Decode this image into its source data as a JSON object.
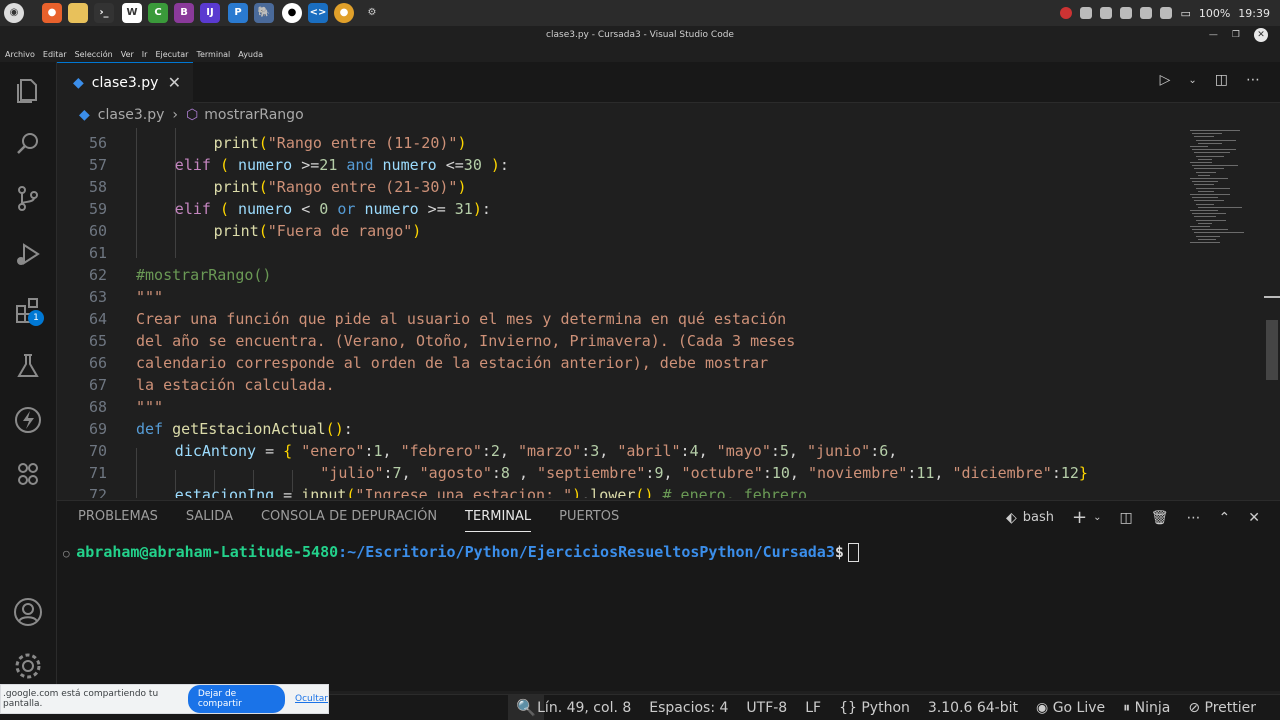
{
  "window": {
    "title": "clase3.py - Cursada3 - Visual Studio Code"
  },
  "os": {
    "taskbar_icons": [
      "menu-icon",
      "firefox-icon",
      "files-icon",
      "terminal-icon",
      "libreoffice-writer-icon",
      "libreoffice-calc-icon",
      "libreoffice-base-icon",
      "intellij-icon",
      "pycharm-icon",
      "postgres-icon",
      "github-icon",
      "vscode-icon",
      "chrome-icon",
      "settings-icon"
    ],
    "battery": "100%",
    "clock": "19:39"
  },
  "menu": [
    "Archivo",
    "Editar",
    "Selección",
    "Ver",
    "Ir",
    "Ejecutar",
    "Terminal",
    "Ayuda"
  ],
  "tab": {
    "label": "clase3.py",
    "close": "✕"
  },
  "breadcrumb": {
    "file": "clase3.py",
    "separator": "›",
    "symbol": "mostrarRango"
  },
  "activity_badge": "1",
  "code": {
    "lines": [
      {
        "n": "56",
        "text": "print(\"Rango entre (11-20)\")"
      },
      {
        "n": "57",
        "text": "elif ( numero >=21 and numero <=30 ):"
      },
      {
        "n": "58",
        "text": "print(\"Rango entre (21-30)\")"
      },
      {
        "n": "59",
        "text": "elif ( numero < 0 or numero >= 31):"
      },
      {
        "n": "60",
        "text": "print(\"Fuera de rango\")"
      },
      {
        "n": "61",
        "text": ""
      },
      {
        "n": "62",
        "text": "#mostrarRango()"
      },
      {
        "n": "63",
        "text": "\"\"\""
      },
      {
        "n": "64",
        "text": "Crear una función que pide al usuario el mes y determina en qué estación"
      },
      {
        "n": "65",
        "text": "del año se encuentra. (Verano, Otoño, Invierno, Primavera). (Cada 3 meses"
      },
      {
        "n": "66",
        "text": "calendario corresponde al orden de la estación anterior), debe mostrar"
      },
      {
        "n": "67",
        "text": "la estación calculada."
      },
      {
        "n": "68",
        "text": "\"\"\""
      },
      {
        "n": "69",
        "text": "def getEstacionActual():"
      },
      {
        "n": "70",
        "text": "dicAntony = { \"enero\":1, \"febrero\":2, \"marzo\":3, \"abril\":4, \"mayo\":5, \"junio\":6,"
      },
      {
        "n": "71",
        "text": "\"julio\":7, \"agosto\":8 , \"septiembre\":9, \"octubre\":10, \"noviembre\":11, \"diciembre\":12}"
      },
      {
        "n": "72",
        "text": "estacionIng = input(\"Ingrese una estacion: \").lower() # enero, febrero"
      }
    ]
  },
  "panel": {
    "tabs": [
      "PROBLEMAS",
      "SALIDA",
      "CONSOLA DE DEPURACIÓN",
      "TERMINAL",
      "PUERTOS"
    ],
    "active_tab": "TERMINAL",
    "shell": "bash",
    "terminal": {
      "user_host": "abraham@abraham-Latitude-5480",
      "path": ":~/Escritorio/Python/EjerciciosResueltosPython/Cursada3",
      "prompt": "$"
    }
  },
  "status": {
    "position": "Lín. 49, col. 8",
    "indent": "Espacios: 4",
    "encoding": "UTF-8",
    "eol": "LF",
    "language": "Python",
    "interpreter": "3.10.6 64-bit",
    "go_live": "Go Live",
    "ninja": "Ninja",
    "prettier": "Prettier"
  },
  "share_banner": {
    "text": ".google.com está compartiendo tu pantalla.",
    "stop": "Dejar de compartir",
    "hide": "Ocultar"
  },
  "colors": {
    "accent": "#0078d4",
    "terminal_user": "#23d18b",
    "terminal_path": "#3b8eea"
  }
}
